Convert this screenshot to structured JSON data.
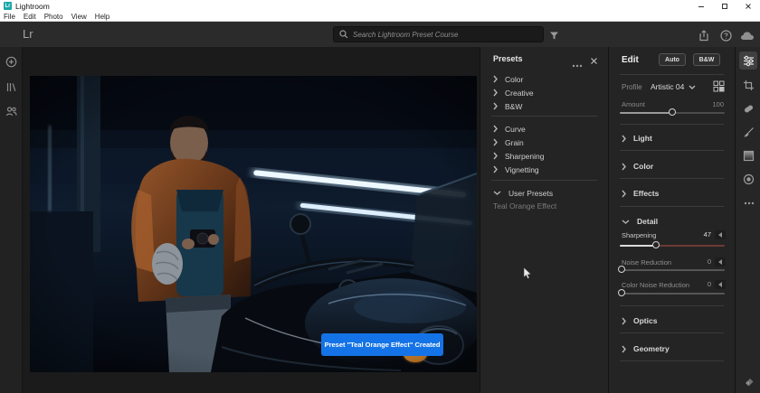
{
  "window": {
    "title": "Lightroom",
    "menus": [
      "File",
      "Edit",
      "Photo",
      "View",
      "Help"
    ]
  },
  "topbar": {
    "logo": "Lr",
    "search_placeholder": "Search Lightroom Preset Course"
  },
  "presets": {
    "title": "Presets",
    "groups1": [
      "Color",
      "Creative",
      "B&W"
    ],
    "groups2": [
      "Curve",
      "Grain",
      "Sharpening",
      "Vignetting"
    ],
    "user_presets_label": "User Presets",
    "user_presets": [
      "Teal Orange Effect"
    ]
  },
  "edit": {
    "title": "Edit",
    "auto_label": "Auto",
    "bw_label": "B&W",
    "profile_label": "Profile",
    "profile_value": "Artistic 04",
    "amount_label": "Amount",
    "amount_value": "100",
    "sections_above": [
      "Light",
      "Color",
      "Effects"
    ],
    "detail_label": "Detail",
    "sliders": [
      {
        "label": "Sharpening",
        "value": "47"
      },
      {
        "label": "Noise Reduction",
        "value": "0"
      },
      {
        "label": "Color Noise Reduction",
        "value": "0"
      }
    ],
    "sections_below": [
      "Optics",
      "Geometry"
    ]
  },
  "toast": {
    "message": "Preset \"Teal Orange Effect\" Created",
    "color": "#1473e6"
  }
}
